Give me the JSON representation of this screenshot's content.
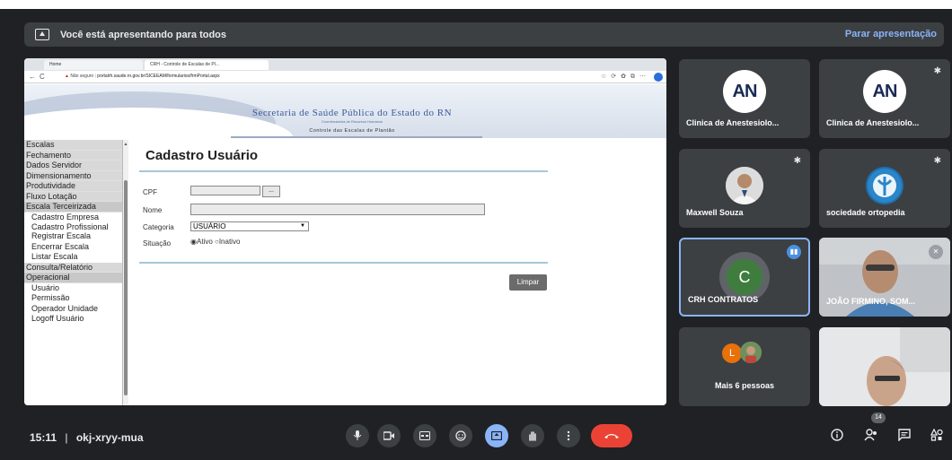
{
  "presentation_bar": {
    "message": "Você está apresentando para todos",
    "stop_label": "Parar apresentação"
  },
  "browser": {
    "tabs": [
      {
        "label": "Home"
      },
      {
        "label": "CRH - Controle de Escalas de Pl..."
      }
    ],
    "address_warning": "Não seguro",
    "url": "portalrh.saude.rn.gov.br/SICEEAM/formularios/frmPortal.aspx"
  },
  "site": {
    "title": "Secretaria de Saúde Pública do Estado do RN",
    "subtitle": "Coordenadoria de Recursos Humanos",
    "system_name": "Controle das Escalas de Plantão"
  },
  "sidebar": {
    "items": [
      {
        "label": "Escalas",
        "type": "section"
      },
      {
        "label": "Fechamento",
        "type": "section"
      },
      {
        "label": "Dados Servidor",
        "type": "section"
      },
      {
        "label": "Dimensionamento",
        "type": "section"
      },
      {
        "label": "Produtividade",
        "type": "section"
      },
      {
        "label": "Fluxo Lotação",
        "type": "section"
      },
      {
        "label": "Escala Terceirizada",
        "type": "section"
      },
      {
        "label": "Cadastro Empresa",
        "type": "sub"
      },
      {
        "label": "Cadastro Profissional",
        "type": "sub"
      },
      {
        "label": "Registrar Escala",
        "type": "sub"
      },
      {
        "label": "Encerrar Escala",
        "type": "sub"
      },
      {
        "label": "Listar Escala",
        "type": "sub"
      },
      {
        "label": "Consulta/Relatório",
        "type": "section"
      },
      {
        "label": "Operacional",
        "type": "section"
      },
      {
        "label": "Usuário",
        "type": "sub"
      },
      {
        "label": "Permissão",
        "type": "sub"
      },
      {
        "label": "Operador Unidade",
        "type": "sub"
      },
      {
        "label": "Logoff Usuário",
        "type": "sub"
      }
    ]
  },
  "form": {
    "title": "Cadastro Usuário",
    "cpf_label": "CPF",
    "cpf_value": "",
    "lookup_button": "...",
    "nome_label": "Nome",
    "nome_value": "",
    "categoria_label": "Categoria",
    "categoria_value": "USUÁRIO",
    "situacao_label": "Situação",
    "situacao_options": [
      "Ativo",
      "Inativo"
    ],
    "situacao_selected": "Ativo",
    "ativo_text": "◉Ativo",
    "inativo_text": "○Inativo",
    "clear_button": "Limpar"
  },
  "participants": [
    {
      "name": "Clinica de Anestesiolo...",
      "logo_text": "AN"
    },
    {
      "name": "Clinica de Anestesiolo...",
      "logo_text": "AN"
    },
    {
      "name": "Maxwell Souza"
    },
    {
      "name": "sociedade ortopedia"
    },
    {
      "name": "CRH CONTRATOS",
      "initial": "C",
      "speaking": true
    },
    {
      "name": "JOÃO FIRMINO, SOM..."
    },
    {
      "name": "Mais 6 pessoas",
      "initial": "L"
    },
    {
      "name": ""
    }
  ],
  "meeting": {
    "time": "15:11",
    "separator": "|",
    "code": "okj-xryy-mua",
    "people_count": "14"
  },
  "colors": {
    "background": "#202124",
    "accent": "#8ab4f8",
    "end_call": "#ea4335",
    "avatar_green": "#3f7d3f"
  }
}
